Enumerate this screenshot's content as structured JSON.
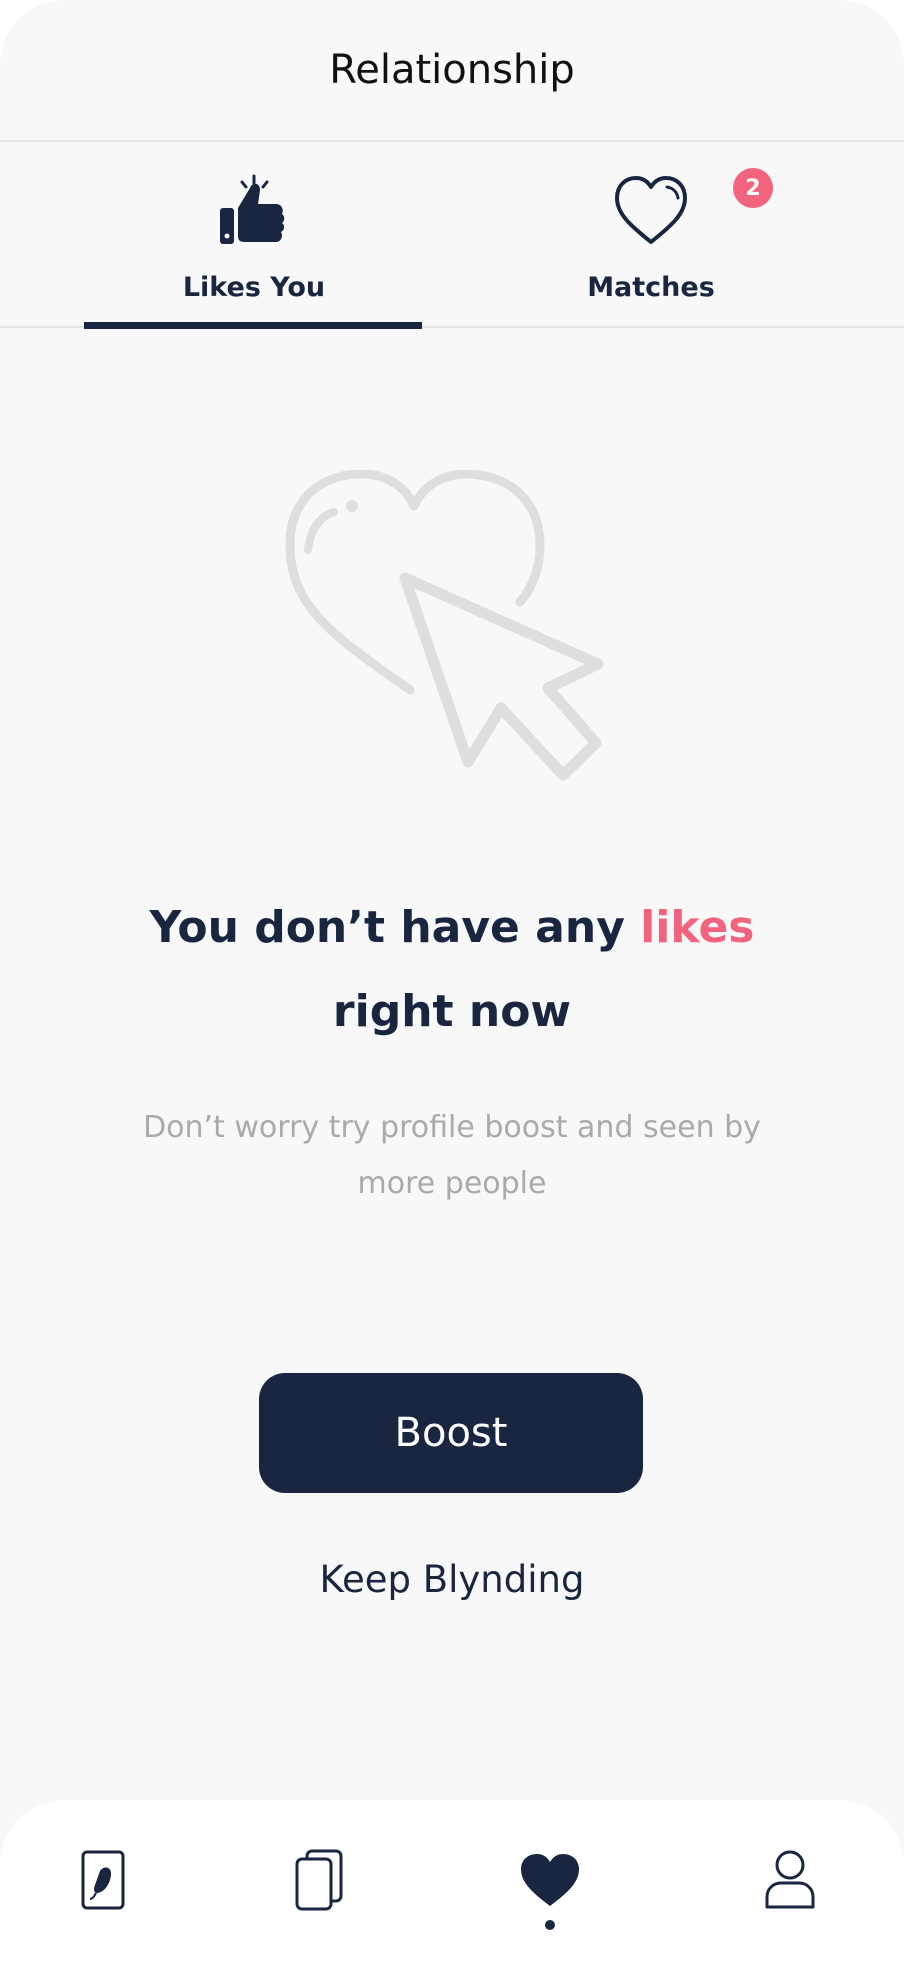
{
  "header": {
    "title": "Relationship"
  },
  "tabs": [
    {
      "label": "Likes You",
      "icon": "thumbs-up-icon",
      "active": true
    },
    {
      "label": "Matches",
      "icon": "heart-outline-icon",
      "active": false,
      "badge": "2"
    }
  ],
  "empty_state": {
    "icon": "heart-cursor-icon",
    "heading_prefix": "You don’t have any ",
    "heading_accent": "likes",
    "heading_suffix": "right now",
    "subtext": "Don’t worry try profile boost and seen by more people"
  },
  "actions": {
    "boost_label": "Boost",
    "keep_label": "Keep Blynding"
  },
  "bottom_nav": {
    "items": [
      {
        "icon": "profile-card-icon"
      },
      {
        "icon": "cards-stack-icon"
      },
      {
        "icon": "heart-filled-icon",
        "active": true
      },
      {
        "icon": "user-icon"
      }
    ]
  },
  "colors": {
    "primary": "#1a2540",
    "accent": "#f2637e",
    "muted_text": "#aaaaaa",
    "background": "#f8f8f8"
  }
}
